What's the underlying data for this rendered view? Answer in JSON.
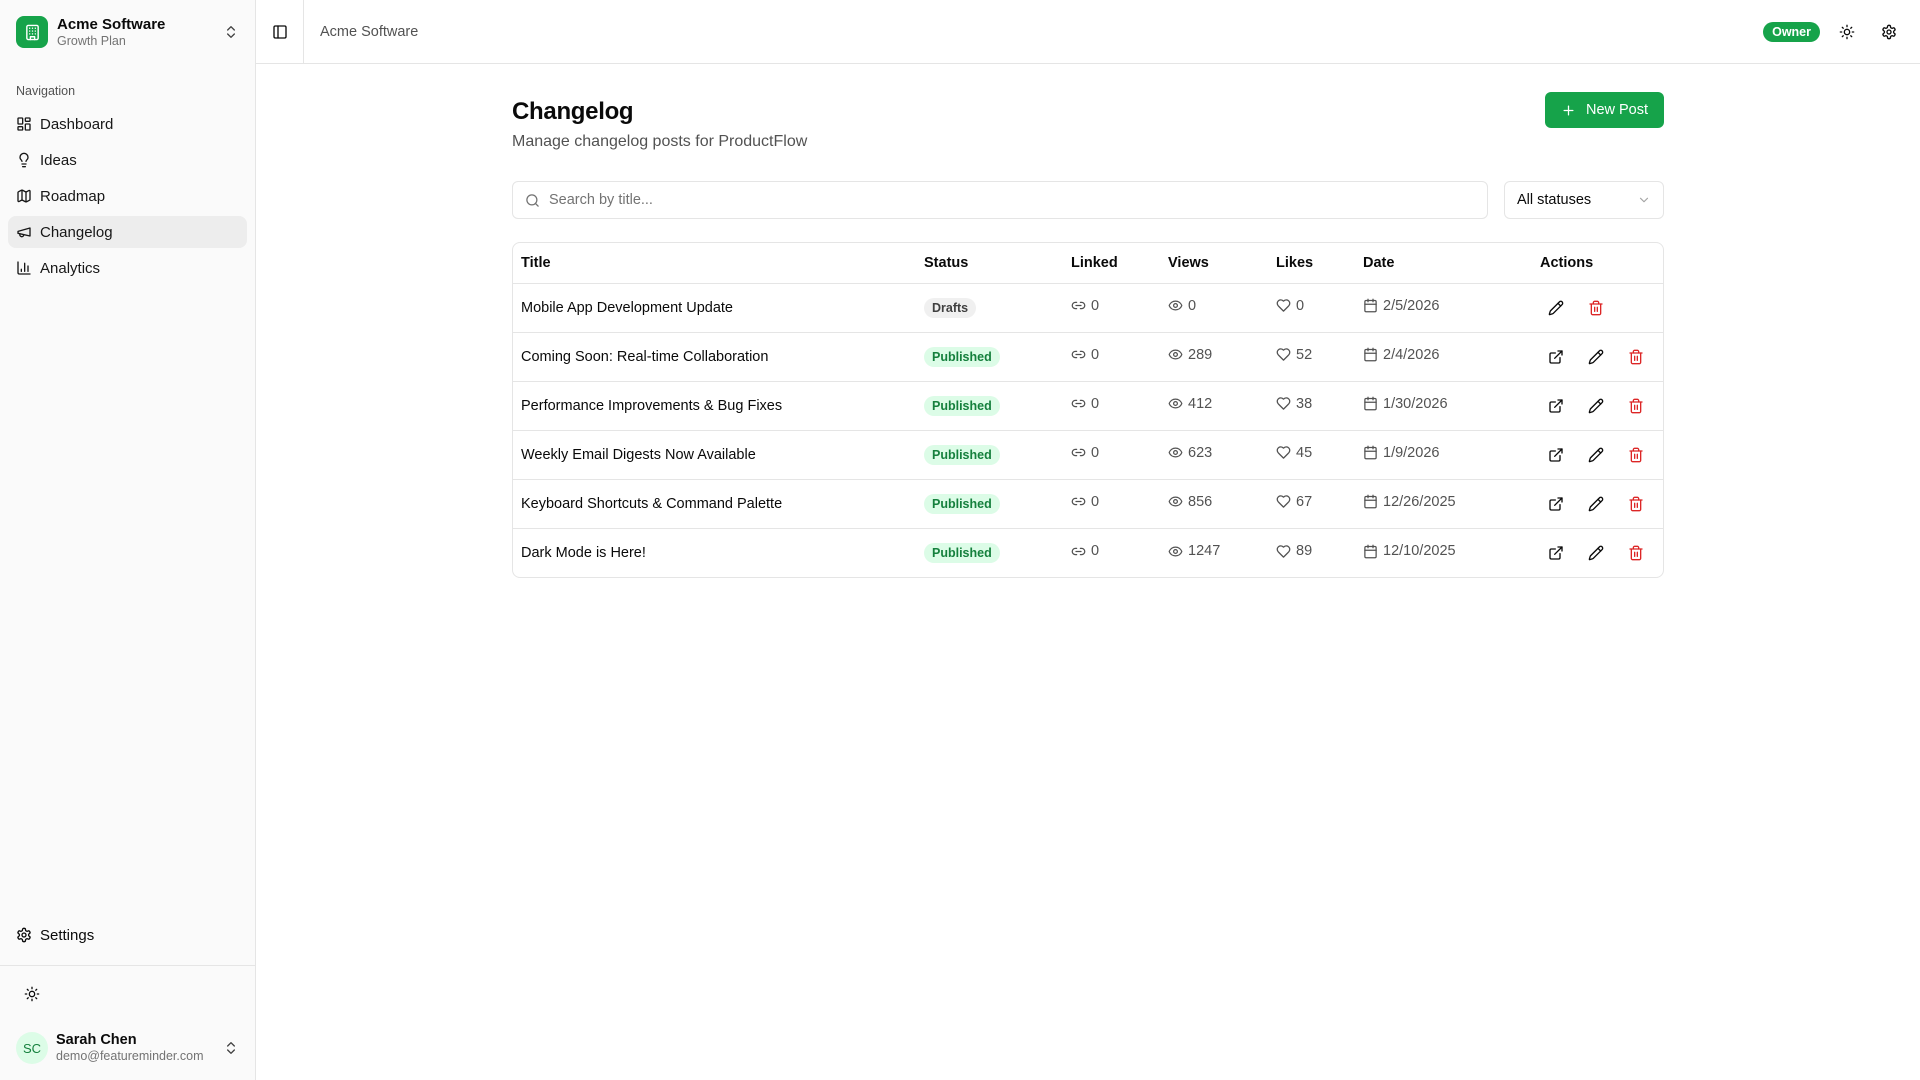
{
  "org": {
    "name": "Acme Software",
    "plan": "Growth Plan"
  },
  "nav": {
    "heading": "Navigation",
    "items": [
      {
        "label": "Dashboard",
        "icon": "layout-grid-icon"
      },
      {
        "label": "Ideas",
        "icon": "lightbulb-icon"
      },
      {
        "label": "Roadmap",
        "icon": "map-icon"
      },
      {
        "label": "Changelog",
        "icon": "megaphone-icon",
        "active": true
      },
      {
        "label": "Analytics",
        "icon": "bar-chart-icon"
      }
    ],
    "settings_label": "Settings"
  },
  "user": {
    "initials": "SC",
    "name": "Sarah Chen",
    "email": "demo@featureminder.com"
  },
  "topbar": {
    "breadcrumb": "Acme Software",
    "role_badge": "Owner"
  },
  "page": {
    "title": "Changelog",
    "subtitle": "Manage changelog posts for ProductFlow",
    "new_post_label": "New Post"
  },
  "filters": {
    "search_placeholder": "Search by title...",
    "status_selected": "All statuses"
  },
  "table": {
    "headers": {
      "title": "Title",
      "status": "Status",
      "linked": "Linked",
      "views": "Views",
      "likes": "Likes",
      "date": "Date",
      "actions": "Actions"
    },
    "rows": [
      {
        "title": "Mobile App Development Update",
        "status": "Drafts",
        "linked": "0",
        "views": "0",
        "likes": "0",
        "date": "2/5/2026"
      },
      {
        "title": "Coming Soon: Real-time Collaboration",
        "status": "Published",
        "linked": "0",
        "views": "289",
        "likes": "52",
        "date": "2/4/2026"
      },
      {
        "title": "Performance Improvements & Bug Fixes",
        "status": "Published",
        "linked": "0",
        "views": "412",
        "likes": "38",
        "date": "1/30/2026"
      },
      {
        "title": "Weekly Email Digests Now Available",
        "status": "Published",
        "linked": "0",
        "views": "623",
        "likes": "45",
        "date": "1/9/2026"
      },
      {
        "title": "Keyboard Shortcuts & Command Palette",
        "status": "Published",
        "linked": "0",
        "views": "856",
        "likes": "67",
        "date": "12/26/2025"
      },
      {
        "title": "Dark Mode is Here!",
        "status": "Published",
        "linked": "0",
        "views": "1247",
        "likes": "89",
        "date": "12/10/2025"
      }
    ]
  },
  "colors": {
    "accent": "#16a34a",
    "danger": "#dc2626",
    "published_bg": "#dcfce7",
    "published_text": "#15803d"
  }
}
